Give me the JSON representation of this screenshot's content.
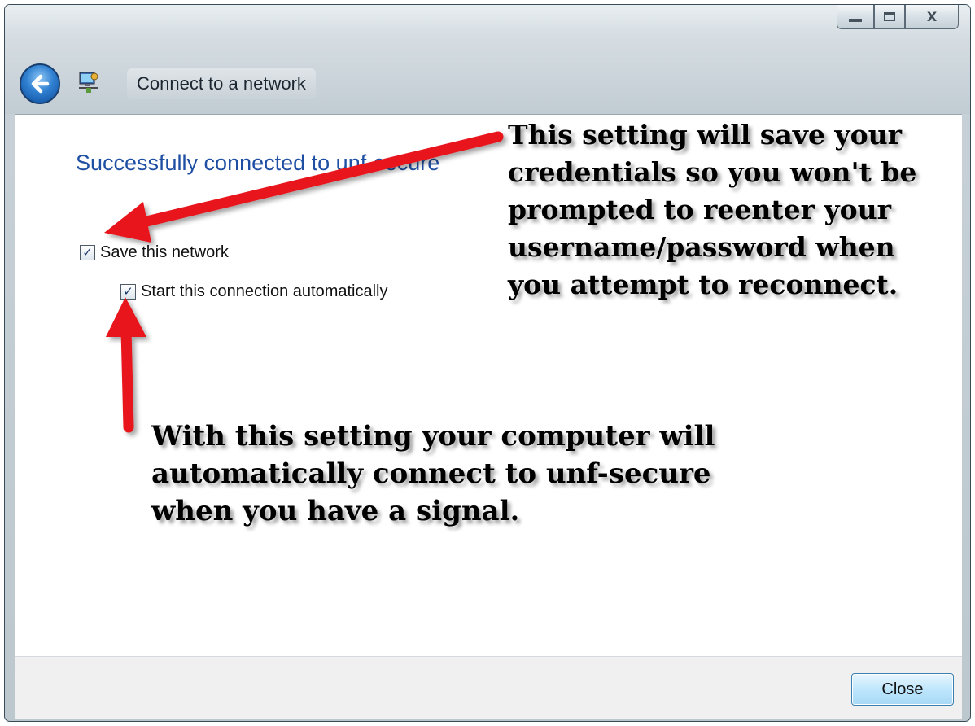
{
  "window": {
    "title": "Connect to a network",
    "caption_buttons": {
      "minimize_icon": "minimize-icon",
      "maximize_icon": "maximize-icon",
      "close_label": "X"
    }
  },
  "content": {
    "heading": "Successfully connected to unf-secure",
    "save_network": {
      "label": "Save this network",
      "checked": true
    },
    "start_auto": {
      "label": "Start this connection automatically",
      "checked": true
    }
  },
  "annotations": {
    "note1_lines": [
      "This setting will save your",
      "credentials so you won't be",
      "prompted to reenter your",
      "username/password when",
      "you attempt to reconnect."
    ],
    "note2_lines": [
      "With this setting your computer will",
      "automatically connect to unf-secure",
      "when you have a signal."
    ],
    "arrow_color": "#e8141b"
  },
  "footer": {
    "close_label": "Close"
  },
  "colors": {
    "heading": "#1f4fa3",
    "window_chrome": "#c2ccd3"
  }
}
